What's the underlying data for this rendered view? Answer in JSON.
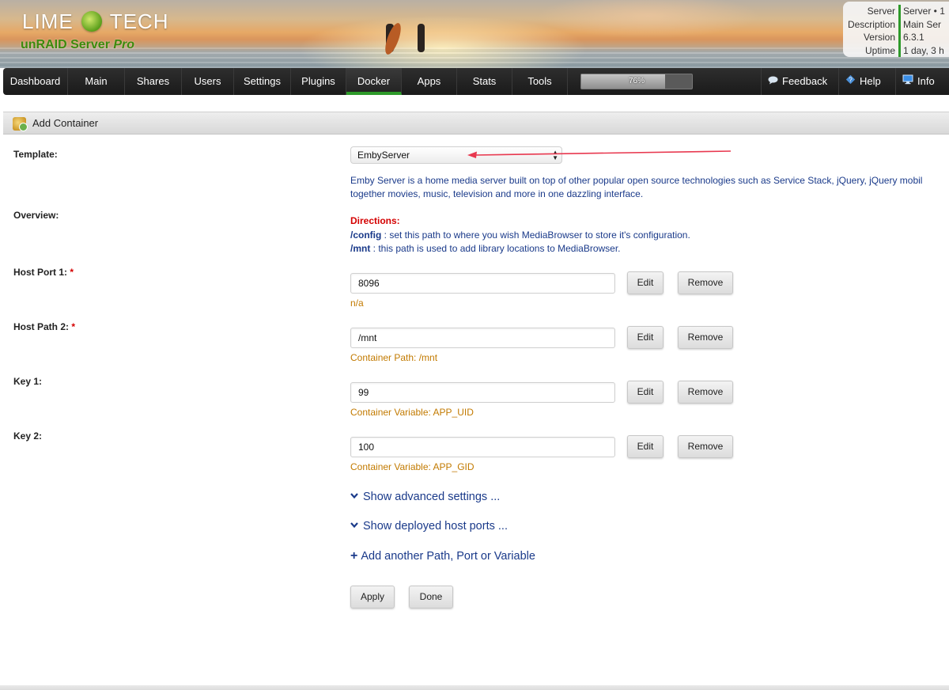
{
  "header": {
    "logo_text_left": "LIME",
    "logo_text_right": "TECH",
    "product_name": "unRAID Server",
    "product_edition": "Pro",
    "server_info": [
      {
        "key": "Server",
        "value": "Server • 1"
      },
      {
        "key": "Description",
        "value": "Main Ser"
      },
      {
        "key": "Version",
        "value": "6.3.1"
      },
      {
        "key": "Uptime",
        "value": "1 day, 3 h"
      }
    ]
  },
  "nav": {
    "items": [
      "Dashboard",
      "Main",
      "Shares",
      "Users",
      "Settings",
      "Plugins",
      "Docker",
      "Apps",
      "Stats",
      "Tools"
    ],
    "active": "Docker",
    "cpu_load_label": "76%",
    "cpu_load_fraction": 0.76,
    "right_items": [
      {
        "label": "Feedback",
        "icon": "speech-bubble-icon"
      },
      {
        "label": "Help",
        "icon": "help-diamond-icon"
      },
      {
        "label": "Info",
        "icon": "monitor-icon"
      }
    ]
  },
  "title_bar": {
    "title": "Add Container",
    "icon": "add-container-icon"
  },
  "form": {
    "template_label": "Template:",
    "template_value": "EmbyServer",
    "overview_label": "Overview:",
    "overview_text_line1": "Emby Server is a home media server built on top of other popular open source technologies such as Service Stack, jQuery, jQuery mobil",
    "overview_text_line2": "together movies, music, television and more in one dazzling interface.",
    "directions_title": "Directions:",
    "directions": [
      {
        "path": "/config",
        "text": " : set this path to where you wish MediaBrowser to store it's configuration."
      },
      {
        "path": "/mnt",
        "text": " : this path is used to add library locations to MediaBrowser."
      }
    ],
    "required_mark": "*",
    "fields": [
      {
        "label": "Host Port 1:",
        "required": true,
        "value": "8096",
        "note": "n/a"
      },
      {
        "label": "Host Path 2:",
        "required": true,
        "value": "/mnt",
        "note": "Container Path: /mnt"
      },
      {
        "label": "Key 1:",
        "required": false,
        "value": "99",
        "note": "Container Variable: APP_UID"
      },
      {
        "label": "Key 2:",
        "required": false,
        "value": "100",
        "note": "Container Variable: APP_GID"
      }
    ],
    "edit_label": "Edit",
    "remove_label": "Remove",
    "show_advanced": "Show advanced settings ...",
    "show_ports": "Show deployed host ports ...",
    "add_another": "Add another Path, Port or Variable",
    "apply_label": "Apply",
    "done_label": "Done"
  },
  "colors": {
    "accent_green": "#2e9a2a",
    "link_blue": "#1a3a8a",
    "note_orange": "#c27a00",
    "required_red": "#d40000",
    "annotation_arrow": "#e8384f"
  }
}
